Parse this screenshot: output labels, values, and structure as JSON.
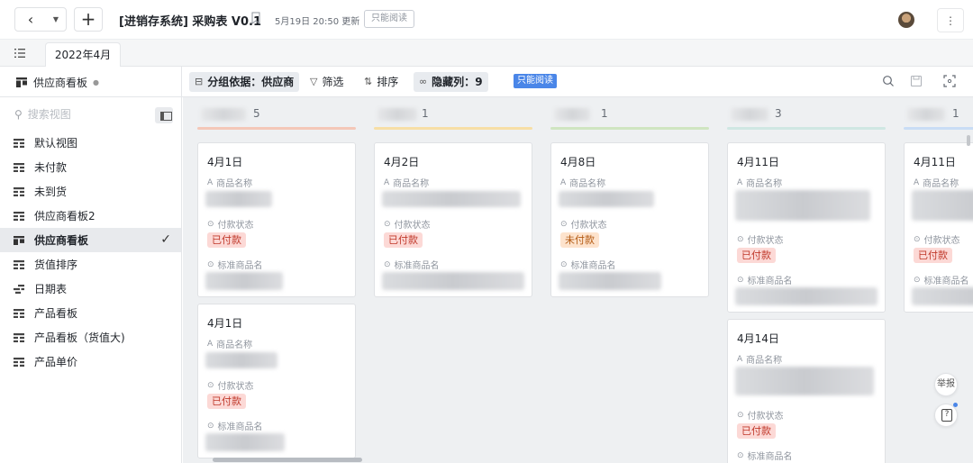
{
  "topbar": {
    "back_icon": "chevron-left-icon",
    "dropdown_icon": "caret-down-icon",
    "add_icon": "plus-icon",
    "title": "[进销存系统] 采购表 V0.1",
    "updated": "5月19日 20:50 更新",
    "readonly_label": "只能阅读",
    "more_icon": "more-vertical-icon"
  },
  "tabs": {
    "list_icon": "list-icon",
    "active_tab": "2022年4月"
  },
  "toolbar": {
    "view_name": "供应商看板",
    "group_label": "分组依据：",
    "group_value": "供应商",
    "filter_label": "筛选",
    "sort_label": "排序",
    "hidden_label": "隐藏列：",
    "hidden_count": "9",
    "readonly_badge": "只能阅读"
  },
  "sidebar": {
    "search_placeholder": "搜索视图",
    "items": [
      {
        "label": "默认视图",
        "icon": "grid-view-icon"
      },
      {
        "label": "未付款",
        "icon": "grid-view-icon"
      },
      {
        "label": "未到货",
        "icon": "grid-view-icon"
      },
      {
        "label": "供应商看板2",
        "icon": "grid-view-icon"
      },
      {
        "label": "供应商看板",
        "icon": "kanban-view-icon"
      },
      {
        "label": "货值排序",
        "icon": "grid-view-icon"
      },
      {
        "label": "日期表",
        "icon": "gantt-view-icon"
      },
      {
        "label": "产品看板",
        "icon": "grid-view-icon"
      },
      {
        "label": "产品看板（货值大)",
        "icon": "grid-view-icon"
      },
      {
        "label": "产品单价",
        "icon": "grid-view-icon"
      }
    ]
  },
  "fields": {
    "name": "商品名称",
    "status": "付款状态",
    "std_name": "标准商品名"
  },
  "columns": [
    {
      "count": "5",
      "color": "#f4c7b8",
      "cards": [
        {
          "date": "4月1日",
          "status": "已付款"
        },
        {
          "date": "4月1日",
          "status": "已付款"
        }
      ]
    },
    {
      "count": "1",
      "color": "#f7dfa6",
      "cards": [
        {
          "date": "4月2日",
          "status": "已付款"
        }
      ]
    },
    {
      "count": "1",
      "color": "#cfe5c1",
      "cards": [
        {
          "date": "4月8日",
          "status": "未付款"
        }
      ]
    },
    {
      "count": "3",
      "color": "#cfe7e3",
      "cards": [
        {
          "date": "4月11日",
          "status": "已付款"
        },
        {
          "date": "4月14日",
          "status": "已付款"
        }
      ]
    },
    {
      "count": "1",
      "color": "#c9ddf5",
      "cards": [
        {
          "date": "4月11日",
          "status": "已付款"
        }
      ]
    }
  ],
  "status_colors": {
    "已付款": {
      "bg": "#fcd9d6",
      "fg": "#c0392b"
    },
    "未付款": {
      "bg": "#fde3cd",
      "fg": "#b35a12"
    }
  },
  "float": {
    "report_label": "举报",
    "help_icon": "help-icon"
  }
}
